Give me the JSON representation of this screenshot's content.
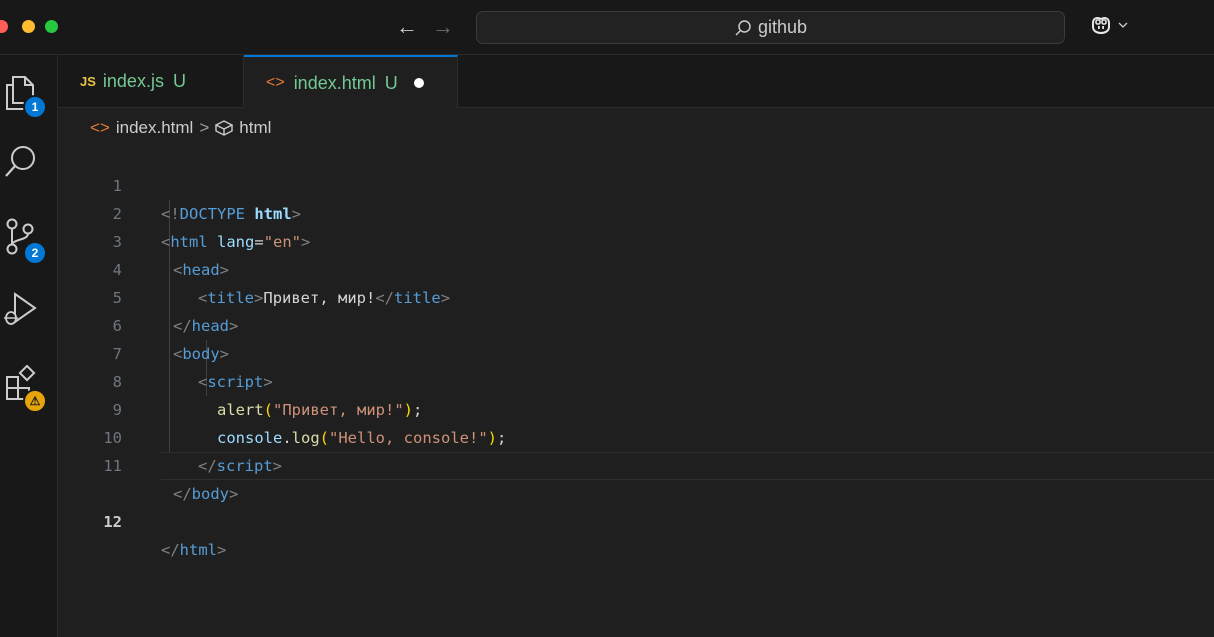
{
  "titlebar": {
    "back_glyph": "←",
    "forward_glyph": "→",
    "search_text": "github",
    "search_icon": "search-icon",
    "copilot_icon": "copilot-icon"
  },
  "activity_bar": {
    "items": [
      {
        "icon": "explorer-icon",
        "badge": "1"
      },
      {
        "icon": "search-icon",
        "badge": ""
      },
      {
        "icon": "source-control-icon",
        "badge": "2"
      },
      {
        "icon": "run-debug-icon",
        "badge": ""
      },
      {
        "icon": "extensions-icon",
        "badge": "⚠"
      }
    ]
  },
  "tabs": [
    {
      "icon_text": "JS",
      "name": "index.js",
      "status": "U",
      "active": false,
      "dirty": false
    },
    {
      "icon_text": "<>",
      "name": "index.html",
      "status": "U",
      "active": true,
      "dirty": true
    }
  ],
  "breadcrumb": {
    "file_icon": "<>",
    "file": "index.html",
    "separator": ">",
    "symbol": "html"
  },
  "editor": {
    "active_line": 12,
    "lines": [
      {
        "num": "1"
      },
      {
        "num": "2"
      },
      {
        "num": "3"
      },
      {
        "num": "4"
      },
      {
        "num": "5"
      },
      {
        "num": "6"
      },
      {
        "num": "7"
      },
      {
        "num": "8"
      },
      {
        "num": "9"
      },
      {
        "num": "10"
      },
      {
        "num": "11"
      },
      {
        "num": "12"
      }
    ],
    "tokens": {
      "l1": [
        "<!",
        "DOCTYPE",
        " ",
        "html",
        ">"
      ],
      "l2": [
        "<",
        "html",
        " ",
        "lang",
        "=",
        "\"en\"",
        ">"
      ],
      "l3": [
        "<",
        "head",
        ">"
      ],
      "l4": [
        "<",
        "title",
        ">",
        "Привет, мир!",
        "</",
        "title",
        ">"
      ],
      "l5": [
        "</",
        "head",
        ">"
      ],
      "l6": [
        "<",
        "body",
        ">"
      ],
      "l7": [
        "<",
        "script",
        ">"
      ],
      "l8": [
        "alert",
        "(",
        "\"Привет, мир!\"",
        ")",
        ";"
      ],
      "l9": [
        "console",
        ".",
        "log",
        "(",
        "\"Hello, console!\"",
        ")",
        ";"
      ],
      "l10": [
        "</",
        "script",
        ">"
      ],
      "l11": [
        "</",
        "body",
        ">"
      ],
      "l12": [
        "</",
        "html",
        ">"
      ]
    }
  },
  "colors": {
    "accent": "#0078d4",
    "untracked": "#73c991",
    "tag": "#569cd6",
    "string": "#ce9178",
    "function": "#dcdcaa",
    "warning": "#e5a50a"
  }
}
